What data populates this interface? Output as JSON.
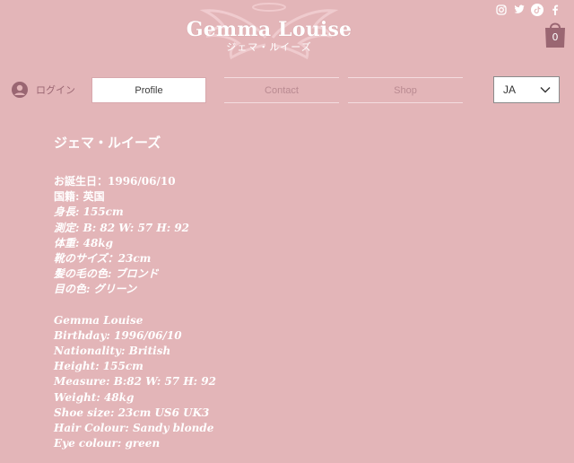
{
  "header": {
    "logo_title": "Gemma Louise",
    "logo_subtitle": "ジェマ・ルイーズ",
    "social_icons": [
      "instagram-icon",
      "twitter-icon",
      "tiktok-icon",
      "facebook-icon"
    ],
    "cart_count": "0"
  },
  "login": {
    "label": "ログイン",
    "icon": "user-avatar-icon"
  },
  "nav": {
    "tabs": [
      {
        "label": "Profile",
        "active": true
      },
      {
        "label": "Contact",
        "active": false
      },
      {
        "label": "Shop",
        "active": false
      }
    ]
  },
  "language_select": {
    "value": "JA"
  },
  "profile": {
    "name_heading": "ジェマ・ルイーズ",
    "japanese_lines": [
      "お誕生日：1996/06/10",
      "国籍: 英国",
      "身長: 155cm",
      "測定: B: 82   W: 57   H: 92",
      "体重: 48kg",
      "靴のサイズ：23cm",
      "髪の毛の色: ブロンド",
      "目の色: グリーン"
    ],
    "english_lines": [
      "Gemma Louise",
      "Birthday: 1996/06/10",
      "Nationality: British",
      "Height: 155cm",
      "Measure: B:82 W: 57 H: 92",
      "Weight: 48kg",
      "Shoe size: 23cm US6 UK3",
      "Hair Colour: Sandy blonde",
      "Eye colour: green"
    ]
  },
  "colors": {
    "background": "#e3b5b8",
    "accent_dark": "#9a6672",
    "text": "#ffffff"
  }
}
